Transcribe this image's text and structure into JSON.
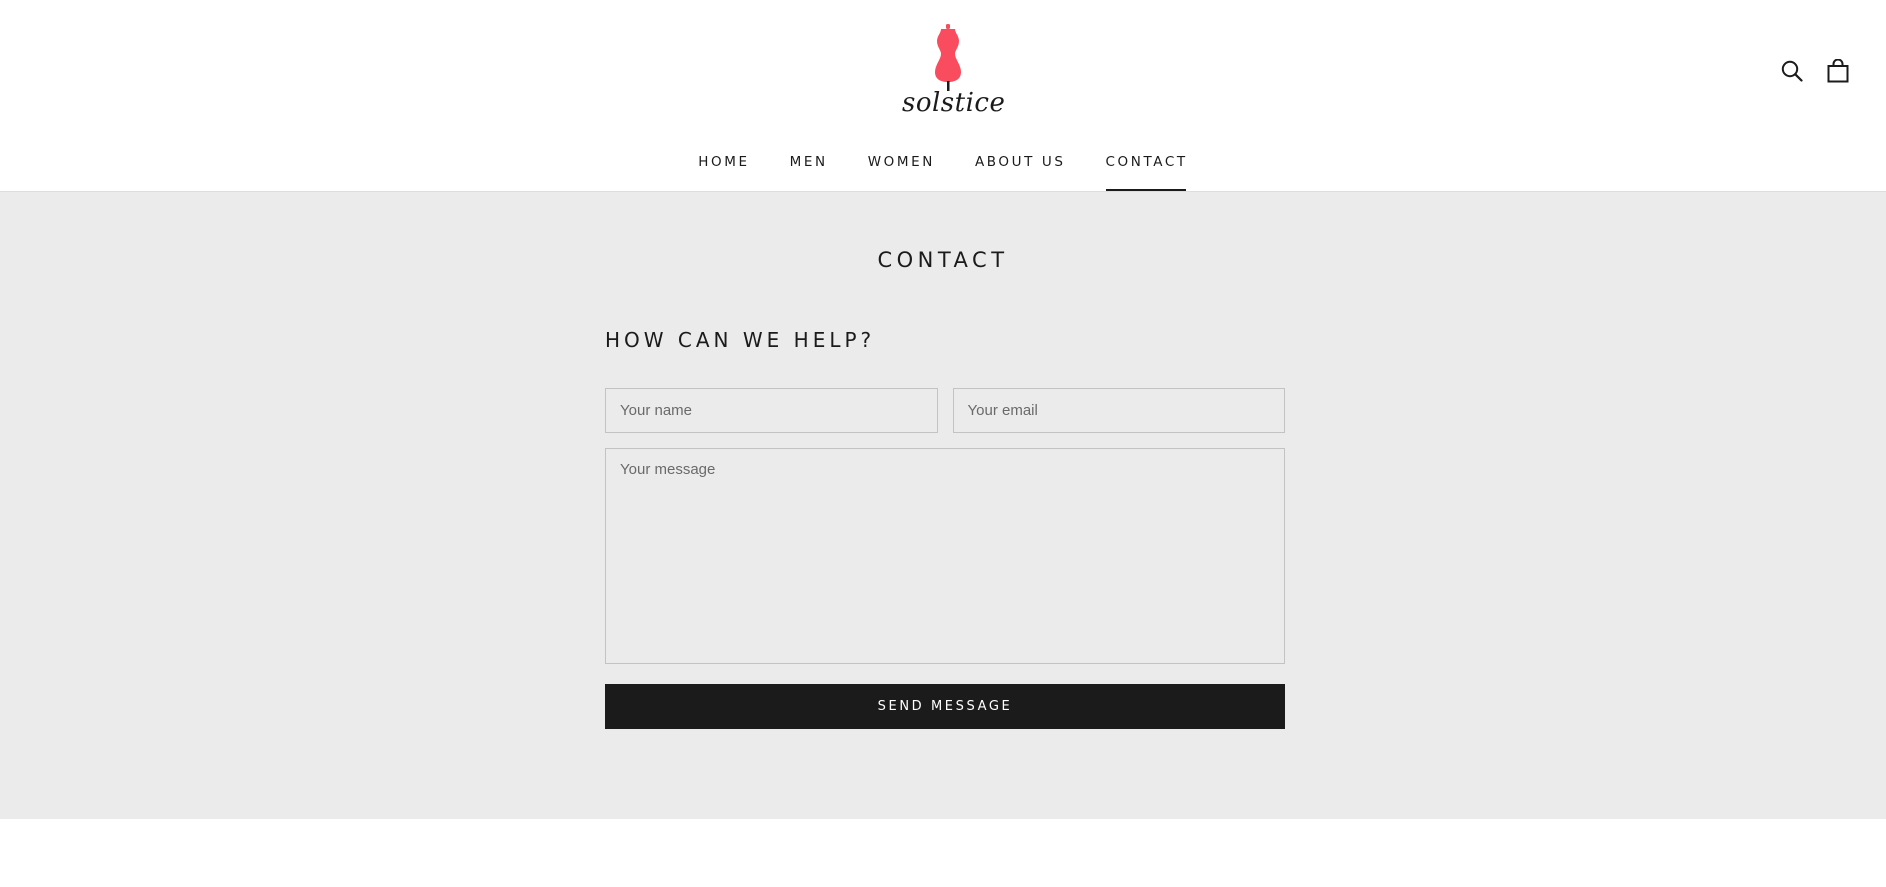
{
  "brand": {
    "name": "solstice",
    "logo_icon": "dress-form-icon",
    "logo_color": "#f94c5e"
  },
  "header": {
    "search_icon": "search-icon",
    "cart_icon": "shopping-bag-icon"
  },
  "nav": {
    "items": [
      {
        "label": "HOME",
        "active": false
      },
      {
        "label": "MEN",
        "active": false
      },
      {
        "label": "WOMEN",
        "active": false
      },
      {
        "label": "ABOUT US",
        "active": false
      },
      {
        "label": "CONTACT",
        "active": true
      }
    ]
  },
  "contact": {
    "title": "CONTACT",
    "heading": "HOW CAN WE HELP?",
    "name_placeholder": "Your name",
    "email_placeholder": "Your email",
    "message_placeholder": "Your message",
    "name_value": "",
    "email_value": "",
    "message_value": "",
    "submit_label": "SEND MESSAGE"
  },
  "colors": {
    "section_bg": "#ebebeb",
    "button_bg": "#1c1b1b",
    "text": "#1c1b1b"
  }
}
